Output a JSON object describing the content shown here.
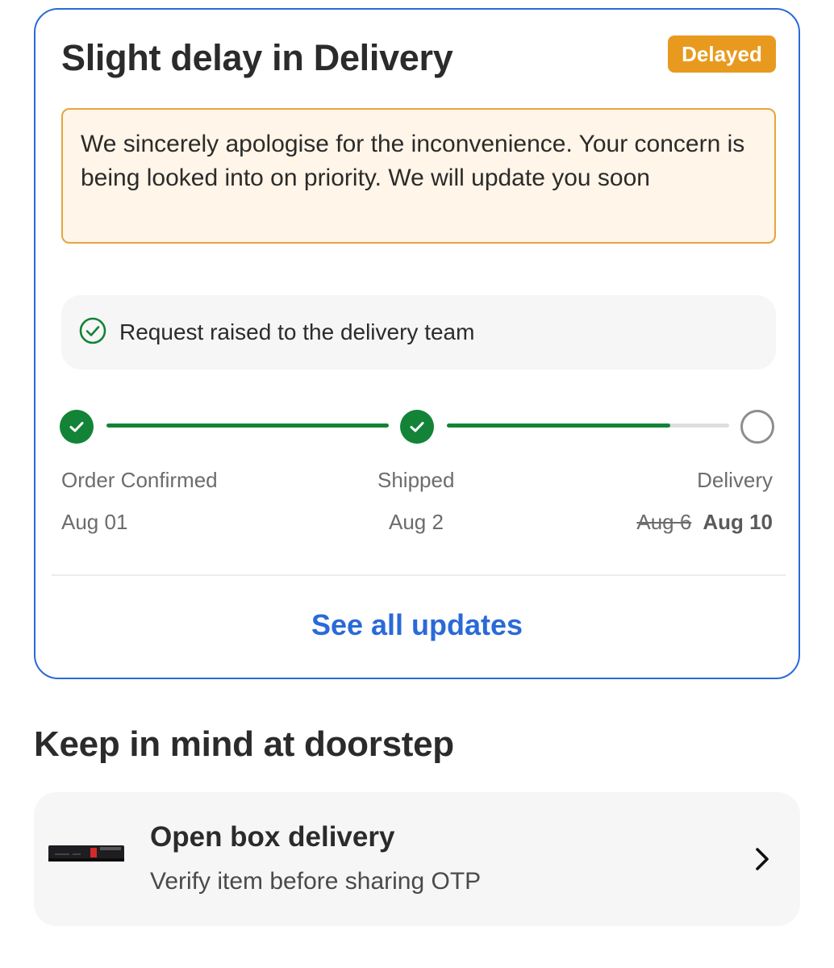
{
  "delivery_card": {
    "title": "Slight delay in Delivery",
    "status_badge": "Delayed",
    "apology_message": "We sincerely apologise for the inconvenience. Your concern is being looked into on priority. We will update you soon",
    "request_status": "Request raised to the delivery team",
    "request_icon": "check-circle-icon",
    "steps": [
      {
        "label": "Order Confirmed",
        "date": "Aug 01",
        "state": "done"
      },
      {
        "label": "Shipped",
        "date": "Aug 2",
        "state": "done"
      },
      {
        "label": "Delivery",
        "original_date": "Aug 6",
        "revised_date": "Aug 10",
        "state": "pending"
      }
    ],
    "shipped_to_delivery_progress": 0.79,
    "see_all_link": "See all updates"
  },
  "doorstep_section": {
    "heading": "Keep in mind at doorstep",
    "item": {
      "title": "Open box delivery",
      "subtitle": "Verify item before sharing OTP",
      "icon": "chevron-right-icon"
    }
  },
  "colors": {
    "accent_blue": "#2a6ad8",
    "badge_orange": "#e89a1f",
    "success_green": "#128337",
    "apology_bg": "#fff5e8",
    "apology_border": "#e6a440"
  }
}
